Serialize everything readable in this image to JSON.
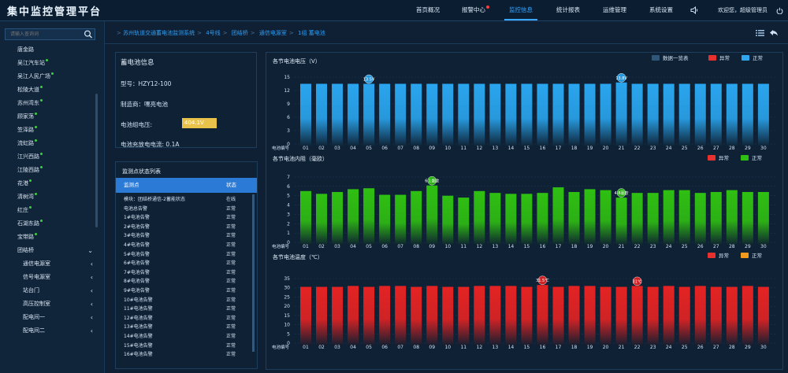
{
  "header": {
    "app_title": "集中监控管理平台",
    "nav": [
      {
        "label": "首页概况",
        "active": false,
        "alert": false
      },
      {
        "label": "报警中心",
        "active": false,
        "alert": true
      },
      {
        "label": "监控信息",
        "active": true,
        "alert": false
      },
      {
        "label": "统计报表",
        "active": false,
        "alert": false
      },
      {
        "label": "运维管理",
        "active": false,
        "alert": false
      },
      {
        "label": "系统设置",
        "active": false,
        "alert": false
      }
    ],
    "user_text": "欢迎您，超级管理员"
  },
  "sidebar": {
    "search_placeholder": "请输入查询词",
    "items": [
      {
        "label": "唐金路",
        "dot": false,
        "indent": 1,
        "chevron": ""
      },
      {
        "label": "吴江汽车站",
        "dot": true,
        "indent": 1,
        "chevron": ""
      },
      {
        "label": "吴江人民广场",
        "dot": true,
        "indent": 1,
        "chevron": ""
      },
      {
        "label": "松陵大道",
        "dot": true,
        "indent": 1,
        "chevron": ""
      },
      {
        "label": "苏州湾东",
        "dot": true,
        "indent": 1,
        "chevron": ""
      },
      {
        "label": "顾家荡",
        "dot": true,
        "indent": 1,
        "chevron": ""
      },
      {
        "label": "笠泽路",
        "dot": true,
        "indent": 1,
        "chevron": ""
      },
      {
        "label": "流虹路",
        "dot": true,
        "indent": 1,
        "chevron": ""
      },
      {
        "label": "江兴西路",
        "dot": true,
        "indent": 1,
        "chevron": ""
      },
      {
        "label": "江陵西路",
        "dot": true,
        "indent": 1,
        "chevron": ""
      },
      {
        "label": "花港",
        "dot": true,
        "indent": 1,
        "chevron": ""
      },
      {
        "label": "清树湾",
        "dot": true,
        "indent": 1,
        "chevron": ""
      },
      {
        "label": "红庄",
        "dot": true,
        "indent": 1,
        "chevron": ""
      },
      {
        "label": "石湖东路",
        "dot": true,
        "indent": 1,
        "chevron": ""
      },
      {
        "label": "宝带路",
        "dot": true,
        "indent": 1,
        "chevron": ""
      },
      {
        "label": "团结桥",
        "dot": false,
        "indent": 1,
        "chevron": "⌄"
      },
      {
        "label": "通信电源室",
        "dot": false,
        "indent": 2,
        "chevron": "‹"
      },
      {
        "label": "信号电源室",
        "dot": false,
        "indent": 2,
        "chevron": "‹"
      },
      {
        "label": "站台门",
        "dot": false,
        "indent": 2,
        "chevron": "‹"
      },
      {
        "label": "高压控制室",
        "dot": false,
        "indent": 2,
        "chevron": "‹"
      },
      {
        "label": "配电间一",
        "dot": false,
        "indent": 2,
        "chevron": "‹"
      },
      {
        "label": "配电间二",
        "dot": false,
        "indent": 2,
        "chevron": "‹"
      }
    ]
  },
  "breadcrumb": [
    "苏州轨道交通蓄电池监测系统",
    "4号线",
    "团结桥",
    "通信电源室",
    "1组 蓄电池"
  ],
  "battery_info": {
    "title": "蓄电池信息",
    "model": "型号：HZY12-100",
    "manufacturer": "制造商：嘿亮电池",
    "group_voltage_label": "电池组电压:",
    "group_voltage_value": "404.1V",
    "current": "电池充放电电流:  0.1A"
  },
  "monitor_list": {
    "title": "监测点状态列表",
    "col_point": "监测点",
    "col_status": "状态",
    "rows": [
      {
        "name": "模块：团结桥通信-2蓄能状态",
        "status": "在线"
      },
      {
        "name": "电池总告警",
        "status": "正常"
      },
      {
        "name": "1#电池告警",
        "status": "正常"
      },
      {
        "name": "2#电池告警",
        "status": "正常"
      },
      {
        "name": "3#电池告警",
        "status": "正常"
      },
      {
        "name": "4#电池告警",
        "status": "正常"
      },
      {
        "name": "5#电池告警",
        "status": "正常"
      },
      {
        "name": "6#电池告警",
        "status": "正常"
      },
      {
        "name": "7#电池告警",
        "status": "正常"
      },
      {
        "name": "8#电池告警",
        "status": "正常"
      },
      {
        "name": "9#电池告警",
        "status": "正常"
      },
      {
        "name": "10#电池告警",
        "status": "正常"
      },
      {
        "name": "11#电池告警",
        "status": "正常"
      },
      {
        "name": "12#电池告警",
        "status": "正常"
      },
      {
        "name": "13#电池告警",
        "status": "正常"
      },
      {
        "name": "14#电池告警",
        "status": "正常"
      },
      {
        "name": "15#电池告警",
        "status": "正常"
      },
      {
        "name": "16#电池告警",
        "status": "正常"
      }
    ]
  },
  "chart_data": [
    {
      "type": "bar",
      "title": "各节电池电压（V）",
      "xlabel": "电池编号",
      "categories": [
        "01",
        "02",
        "03",
        "04",
        "05",
        "06",
        "07",
        "08",
        "09",
        "10",
        "11",
        "12",
        "13",
        "14",
        "15",
        "16",
        "17",
        "18",
        "19",
        "20",
        "21",
        "22",
        "23",
        "24",
        "25",
        "26",
        "27",
        "28",
        "29",
        "30"
      ],
      "values": [
        13.5,
        13.5,
        13.5,
        13.5,
        13.5,
        13.5,
        13.5,
        13.5,
        13.5,
        13.5,
        13.5,
        13.5,
        13.5,
        13.5,
        13.5,
        13.5,
        13.5,
        13.5,
        13.5,
        13.5,
        13.8,
        13.5,
        13.5,
        13.5,
        13.5,
        13.5,
        13.5,
        13.5,
        13.5,
        13.5
      ],
      "ylim": [
        0,
        15
      ],
      "yticks": [
        0,
        3,
        6,
        9,
        12,
        15
      ],
      "color": "#2aa5ee",
      "annotations": [
        {
          "index": 4,
          "text": "13.5V"
        },
        {
          "index": 20,
          "text": "13.8V"
        }
      ],
      "legend": [
        {
          "label": "数据一览表",
          "color": "#2f5677"
        },
        {
          "label": "异常",
          "color": "#e8302f"
        },
        {
          "label": "正常",
          "color": "#2ea6f0"
        }
      ]
    },
    {
      "type": "bar",
      "title": "各节电池内阻（毫欧）",
      "xlabel": "电池编号",
      "categories": [
        "01",
        "02",
        "03",
        "04",
        "05",
        "06",
        "07",
        "08",
        "09",
        "10",
        "11",
        "12",
        "13",
        "14",
        "15",
        "16",
        "17",
        "18",
        "19",
        "20",
        "21",
        "22",
        "23",
        "24",
        "25",
        "26",
        "27",
        "28",
        "29",
        "30"
      ],
      "values": [
        5.5,
        5.2,
        5.4,
        5.7,
        5.8,
        5.1,
        5.1,
        5.5,
        6.1,
        5.0,
        4.8,
        5.5,
        5.3,
        5.2,
        5.2,
        5.3,
        5.9,
        5.4,
        5.7,
        5.6,
        4.8,
        5.3,
        5.3,
        5.6,
        5.6,
        5.3,
        5.4,
        5.6,
        5.4,
        5.4
      ],
      "ylim": [
        0,
        7
      ],
      "yticks": [
        0,
        1,
        2,
        3,
        4,
        5,
        6,
        7
      ],
      "color": "#2fbf12",
      "annotations": [
        {
          "index": 8,
          "text": "6.1毫欧"
        },
        {
          "index": 20,
          "text": "4.8毫欧"
        }
      ],
      "legend": [
        {
          "label": "异常",
          "color": "#e8302f"
        },
        {
          "label": "正常",
          "color": "#2fbf12"
        }
      ]
    },
    {
      "type": "bar",
      "title": "各节电池温度（℃）",
      "xlabel": "电池编号",
      "categories": [
        "01",
        "02",
        "03",
        "04",
        "05",
        "06",
        "07",
        "08",
        "09",
        "10",
        "11",
        "12",
        "13",
        "14",
        "15",
        "16",
        "17",
        "18",
        "19",
        "20",
        "21",
        "22",
        "23",
        "24",
        "25",
        "26",
        "27",
        "28",
        "29",
        "30"
      ],
      "values": [
        30.5,
        30.5,
        30.5,
        31,
        30.5,
        31,
        31,
        30.5,
        31,
        30.5,
        30.5,
        31,
        31,
        31,
        30.5,
        31.5,
        30.5,
        31,
        31,
        30.5,
        30.5,
        31,
        30.5,
        31,
        30.5,
        31,
        30.5,
        30.5,
        31,
        30.5
      ],
      "ylim": [
        0,
        35
      ],
      "yticks": [
        0,
        5,
        10,
        15,
        20,
        25,
        30,
        35
      ],
      "color": "#e42323",
      "annotations": [
        {
          "index": 15,
          "text": "31.5℃"
        },
        {
          "index": 21,
          "text": "31℃"
        }
      ],
      "legend": [
        {
          "label": "异常",
          "color": "#e8302f"
        },
        {
          "label": "正常",
          "color": "#f29a1e"
        }
      ]
    }
  ]
}
